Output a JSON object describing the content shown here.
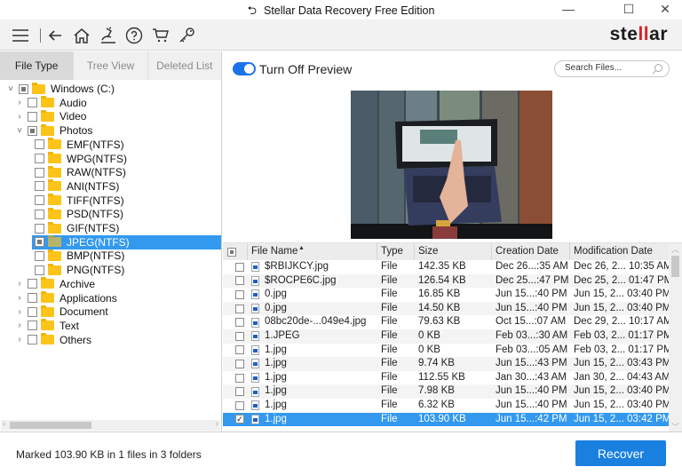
{
  "titlebar": {
    "title": "Stellar Data Recovery Free Edition",
    "back_glyph": "⮌",
    "minimize": "—",
    "maximize": "☐",
    "close": "✕"
  },
  "toolbar": {
    "icons": [
      "menu-icon",
      "back-arrow-icon",
      "home-icon",
      "scan-icon",
      "help-icon",
      "cart-icon",
      "key-icon"
    ],
    "logo": {
      "pre": "ste",
      "mid": "ll",
      "post": "ar"
    },
    "brand_color": "#d2232a"
  },
  "left_panel": {
    "tabs": [
      {
        "label": "File Type",
        "active": true
      },
      {
        "label": "Tree View",
        "active": false
      },
      {
        "label": "Deleted List",
        "active": false
      }
    ],
    "tree": [
      {
        "label": "Windows (C:)",
        "level": 0,
        "caret": "⌄",
        "check": "partial",
        "selected": false
      },
      {
        "label": "Audio",
        "level": 1,
        "caret": "›",
        "check": "none",
        "selected": false
      },
      {
        "label": "Video",
        "level": 1,
        "caret": "›",
        "check": "none",
        "selected": false
      },
      {
        "label": "Photos",
        "level": 1,
        "caret": "⌄",
        "check": "partial",
        "selected": false
      },
      {
        "label": "EMF(NTFS)",
        "level": 2,
        "caret": "",
        "check": "none",
        "selected": false
      },
      {
        "label": "WPG(NTFS)",
        "level": 2,
        "caret": "",
        "check": "none",
        "selected": false
      },
      {
        "label": "RAW(NTFS)",
        "level": 2,
        "caret": "",
        "check": "none",
        "selected": false
      },
      {
        "label": "ANI(NTFS)",
        "level": 2,
        "caret": "",
        "check": "none",
        "selected": false
      },
      {
        "label": "TIFF(NTFS)",
        "level": 2,
        "caret": "",
        "check": "none",
        "selected": false
      },
      {
        "label": "PSD(NTFS)",
        "level": 2,
        "caret": "",
        "check": "none",
        "selected": false
      },
      {
        "label": "GIF(NTFS)",
        "level": 2,
        "caret": "",
        "check": "none",
        "selected": false
      },
      {
        "label": "JPEG(NTFS)",
        "level": 2,
        "caret": "",
        "check": "partial",
        "selected": true
      },
      {
        "label": "BMP(NTFS)",
        "level": 2,
        "caret": "",
        "check": "none",
        "selected": false
      },
      {
        "label": "PNG(NTFS)",
        "level": 2,
        "caret": "",
        "check": "none",
        "selected": false
      },
      {
        "label": "Archive",
        "level": 1,
        "caret": "›",
        "check": "none",
        "selected": false
      },
      {
        "label": "Applications",
        "level": 1,
        "caret": "›",
        "check": "none",
        "selected": false
      },
      {
        "label": "Document",
        "level": 1,
        "caret": "›",
        "check": "none",
        "selected": false
      },
      {
        "label": "Text",
        "level": 1,
        "caret": "›",
        "check": "none",
        "selected": false
      },
      {
        "label": "Others",
        "level": 1,
        "caret": "›",
        "check": "none",
        "selected": false
      }
    ]
  },
  "preview": {
    "toggle_label": "Turn Off Preview",
    "toggle_on": true,
    "search_placeholder": "Search Files...",
    "image_description": "hand touching laptop screen on wooden table"
  },
  "file_table": {
    "columns": [
      "File Name",
      "Type",
      "Size",
      "Creation Date",
      "Modification Date"
    ],
    "sorted_by": "File Name",
    "rows": [
      {
        "name": "$RBIJKCY.jpg",
        "type": "File",
        "size": "142.35 KB",
        "created": "Dec 26...:35 AM",
        "modified": "Dec 26, 2... 10:35 AM",
        "checked": false,
        "selected": false
      },
      {
        "name": "$ROCPE6C.jpg",
        "type": "File",
        "size": "126.54 KB",
        "created": "Dec 25...:47 PM",
        "modified": "Dec 25, 2... 01:47 PM",
        "checked": false,
        "selected": false
      },
      {
        "name": "0.jpg",
        "type": "File",
        "size": "16.85 KB",
        "created": "Jun 15...:40 PM",
        "modified": "Jun 15, 2... 03:40 PM",
        "checked": false,
        "selected": false
      },
      {
        "name": "0.jpg",
        "type": "File",
        "size": "14.50 KB",
        "created": "Jun 15...:40 PM",
        "modified": "Jun 15, 2... 03:40 PM",
        "checked": false,
        "selected": false
      },
      {
        "name": "08bc20de-...049e4.jpg",
        "type": "File",
        "size": "79.63 KB",
        "created": "Oct 15...:07 AM",
        "modified": "Dec 29, 2... 10:17 AM",
        "checked": false,
        "selected": false
      },
      {
        "name": "1.JPEG",
        "type": "File",
        "size": "0 KB",
        "created": "Feb 03...:30 AM",
        "modified": "Feb 03, 2... 01:17 PM",
        "checked": false,
        "selected": false
      },
      {
        "name": "1.jpg",
        "type": "File",
        "size": "0 KB",
        "created": "Feb 03...:05 AM",
        "modified": "Feb 03, 2... 01:17 PM",
        "checked": false,
        "selected": false
      },
      {
        "name": "1.jpg",
        "type": "File",
        "size": "9.74 KB",
        "created": "Jun 15...:43 PM",
        "modified": "Jun 15, 2... 03:43 PM",
        "checked": false,
        "selected": false
      },
      {
        "name": "1.jpg",
        "type": "File",
        "size": "112.55 KB",
        "created": "Jan 30...:43 AM",
        "modified": "Jan 30, 2... 04:43 AM",
        "checked": false,
        "selected": false
      },
      {
        "name": "1.jpg",
        "type": "File",
        "size": "7.98 KB",
        "created": "Jun 15...:40 PM",
        "modified": "Jun 15, 2... 03:40 PM",
        "checked": false,
        "selected": false
      },
      {
        "name": "1.jpg",
        "type": "File",
        "size": "6.32 KB",
        "created": "Jun 15...:40 PM",
        "modified": "Jun 15, 2... 03:40 PM",
        "checked": false,
        "selected": false
      },
      {
        "name": "1.jpg",
        "type": "File",
        "size": "103.90 KB",
        "created": "Jun 15...:42 PM",
        "modified": "Jun 15, 2... 03:42 PM",
        "checked": true,
        "selected": true
      }
    ]
  },
  "statusbar": {
    "text": "Marked 103.90 KB in 1 files in 3 folders",
    "recover_label": "Recover"
  },
  "colors": {
    "accent": "#1a80e0",
    "selection": "#3399ee",
    "folder": "#fcc419"
  }
}
